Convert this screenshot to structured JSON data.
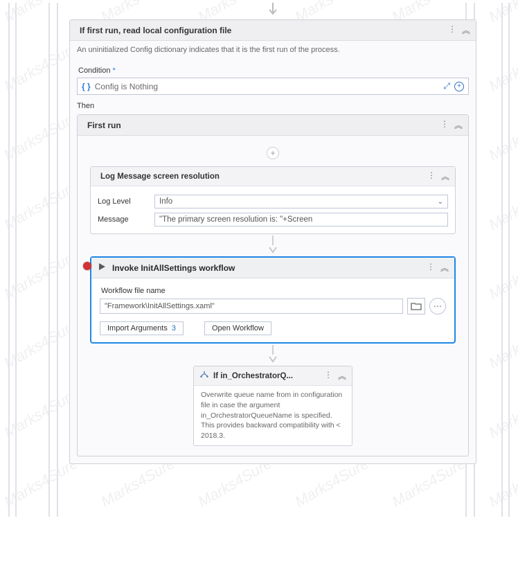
{
  "watermark": "Marks4Sure",
  "ifActivity": {
    "title": "If first run, read local configuration file",
    "description": "An uninitialized Config dictionary indicates that it is the first run of the process.",
    "conditionLabel": "Condition",
    "conditionExpr": "Config is Nothing",
    "thenLabel": "Then"
  },
  "firstRun": {
    "title": "First run"
  },
  "logMessage": {
    "title": "Log Message screen resolution",
    "logLevelLabel": "Log Level",
    "logLevelValue": "Info",
    "messageLabel": "Message",
    "messageValue": "\"The primary screen resolution is: \"+Screen"
  },
  "invoke": {
    "title": "Invoke InitAllSettings workflow",
    "fileLabel": "Workflow file name",
    "filePath": "\"Framework\\InitAllSettings.xaml\"",
    "importArgsLabel": "Import Arguments",
    "importArgsCount": "3",
    "openWorkflowLabel": "Open Workflow"
  },
  "innerIf": {
    "title": "If in_OrchestratorQ...",
    "description": "Overwrite queue name from in configuration file in case the argument in_OrchestratorQueueName is specified.\nThis provides backward compatibility with < 2018.3."
  }
}
